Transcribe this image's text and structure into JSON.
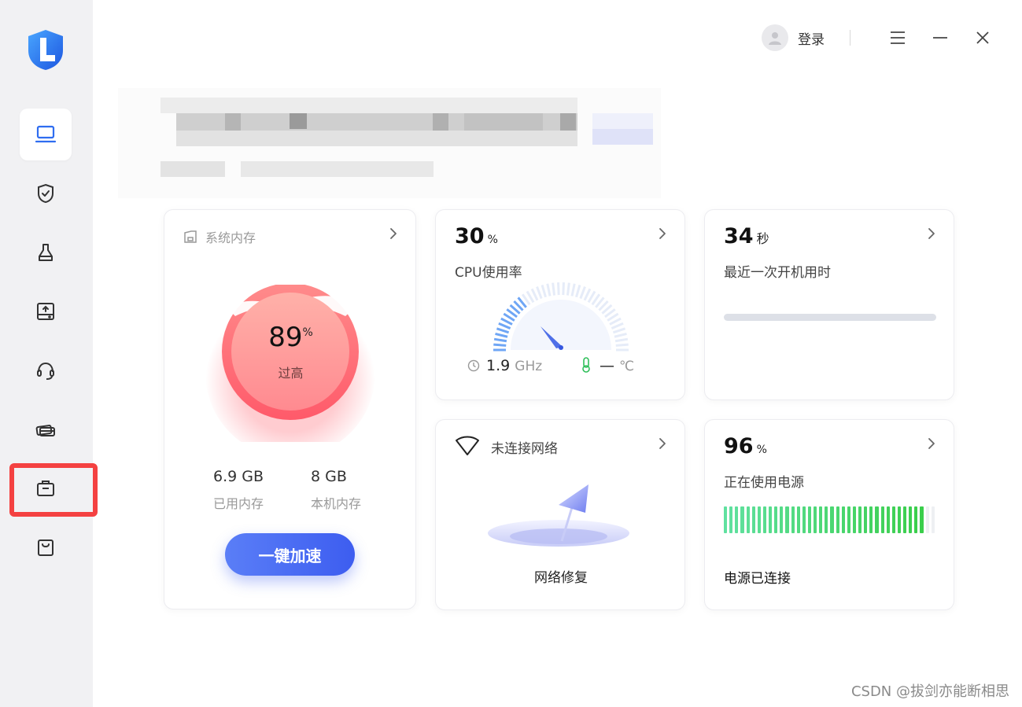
{
  "app": {
    "login_label": "登录",
    "brand_color": "#2f6df0"
  },
  "sidebar": {
    "items": [
      {
        "icon": "laptop-icon",
        "active": true
      },
      {
        "icon": "shield-check-icon",
        "active": false
      },
      {
        "icon": "broom-icon",
        "active": false
      },
      {
        "icon": "drive-upload-icon",
        "active": false
      },
      {
        "icon": "headset-icon",
        "active": false
      },
      {
        "icon": "cards-icon",
        "active": false
      },
      {
        "icon": "toolbox-icon",
        "active": false,
        "highlighted": true
      },
      {
        "icon": "shopping-bag-icon",
        "active": false
      }
    ]
  },
  "memory": {
    "title": "系统内存",
    "percent": "89",
    "percent_unit": "%",
    "status": "过高",
    "used_value": "6.9 GB",
    "used_label": "已用内存",
    "total_value": "8 GB",
    "total_label": "本机内存",
    "boost_label": "一键加速"
  },
  "cpu": {
    "percent": "30",
    "percent_unit": "%",
    "label": "CPU使用率",
    "freq_value": "1.9",
    "freq_unit": "GHz",
    "temp_value": "—",
    "temp_unit": "℃",
    "usage_fraction": 0.3
  },
  "boot": {
    "value": "34",
    "unit": "秒",
    "label": "最近一次开机用时"
  },
  "network": {
    "status": "未连接网络",
    "action": "网络修复"
  },
  "battery": {
    "percent": "96",
    "percent_unit": "%",
    "label": "正在使用电源",
    "status": "电源已连接",
    "level": 0.96
  },
  "watermark": "CSDN @拔剑亦能断相思"
}
